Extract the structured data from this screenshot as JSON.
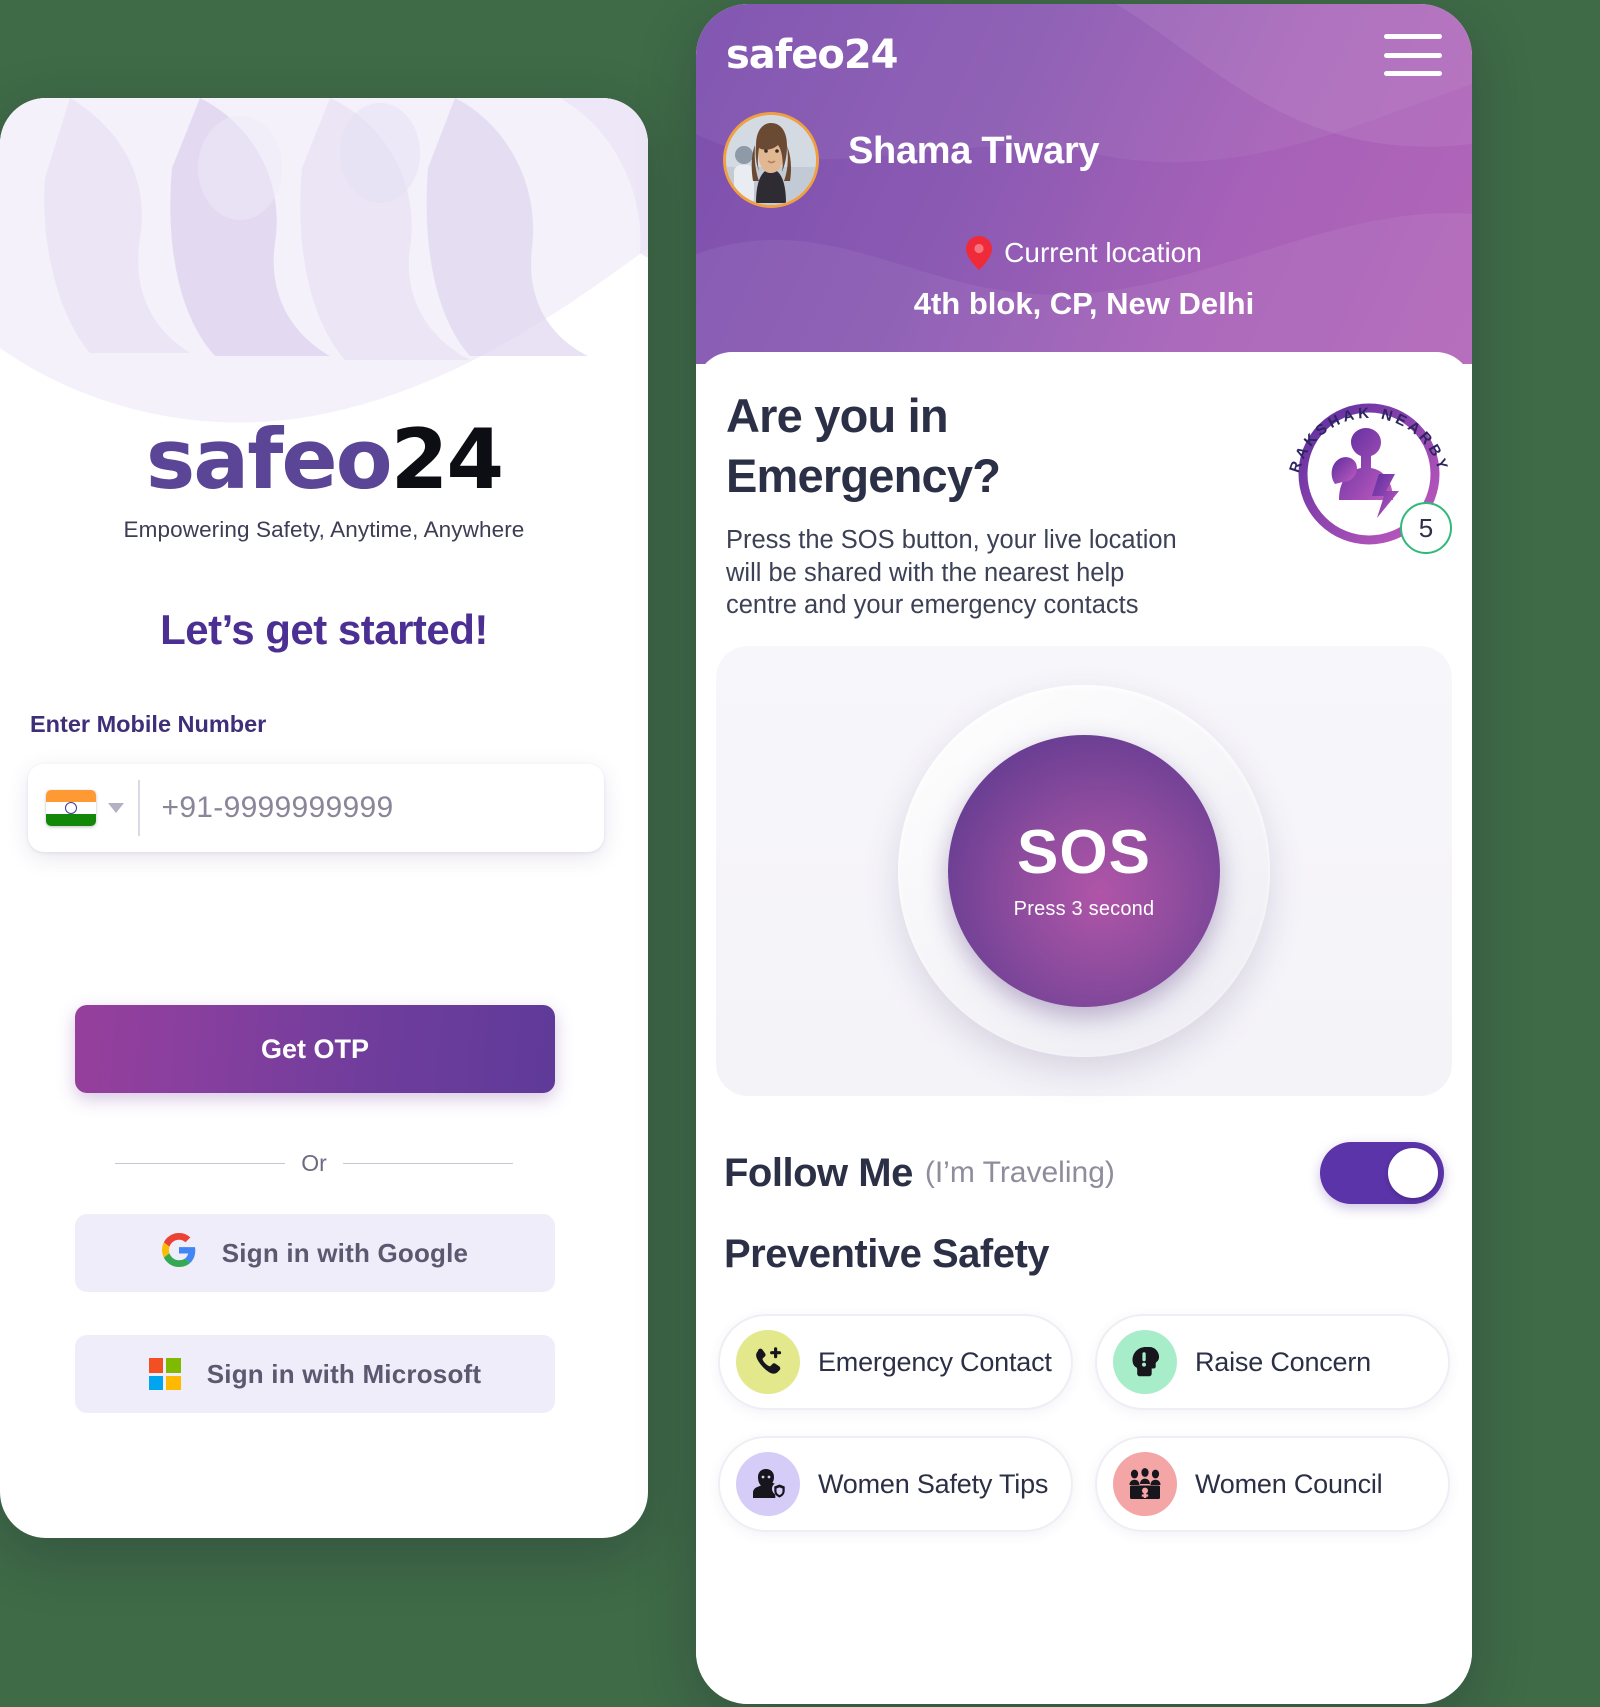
{
  "login": {
    "brand": {
      "part1": "safeo",
      "part2": "24",
      "tagline": "Empowering Safety, Anytime, Anywhere"
    },
    "heading": "Let’s get started!",
    "mobile_label": "Enter Mobile Number",
    "mobile_placeholder": "+91-9999999999",
    "mobile_value": "",
    "country_flag": "india-flag-icon",
    "get_otp_label": "Get OTP",
    "divider_text": "Or",
    "google_label": "Sign in with Google",
    "microsoft_label": "Sign in with Microsoft",
    "colors": {
      "brand_purple": "#5b4596",
      "heading_purple": "#4b2f93",
      "otp_gradient_start": "#963f9c",
      "otp_gradient_end": "#5f3a99",
      "sso_bg": "#f0edfa"
    }
  },
  "dashboard": {
    "brand": "safeo24",
    "menu_icon": "hamburger-menu-icon",
    "user_name": "Shama Tiwary",
    "location_icon": "map-pin-icon",
    "location_label": "Current location",
    "location_address": "4th blok, CP, New Delhi",
    "emergency": {
      "title_line1": "Are you in",
      "title_line2": "Emergency?",
      "description": "Press the SOS button, your live location will be shared with the nearest help centre and your emergency contacts"
    },
    "rakshak": {
      "badge_text": "RAKSHAK NEARBY",
      "count": "5"
    },
    "sos": {
      "label": "SOS",
      "hint": "Press 3 second"
    },
    "follow_me": {
      "title": "Follow Me",
      "subtitle": "(I’m Traveling)",
      "enabled": true
    },
    "preventive_safety_title": "Preventive Safety",
    "safety_cards": [
      {
        "label": "Emergency Contact",
        "icon": "phone-plus-icon",
        "bg": "#e3e88c"
      },
      {
        "label": "Raise Concern",
        "icon": "head-alert-icon",
        "bg": "#a8edc9"
      },
      {
        "label": "Women Safety Tips",
        "icon": "woman-shield-icon",
        "bg": "#d5cdf7"
      },
      {
        "label": "Women Council",
        "icon": "council-icon",
        "bg": "#f4a5a5"
      }
    ],
    "colors": {
      "header_start": "#7c4fad",
      "header_end": "#b266b8",
      "pin_red": "#ef2b3a",
      "toggle_on": "#5a34a8",
      "count_ring": "#2fb97a"
    }
  }
}
